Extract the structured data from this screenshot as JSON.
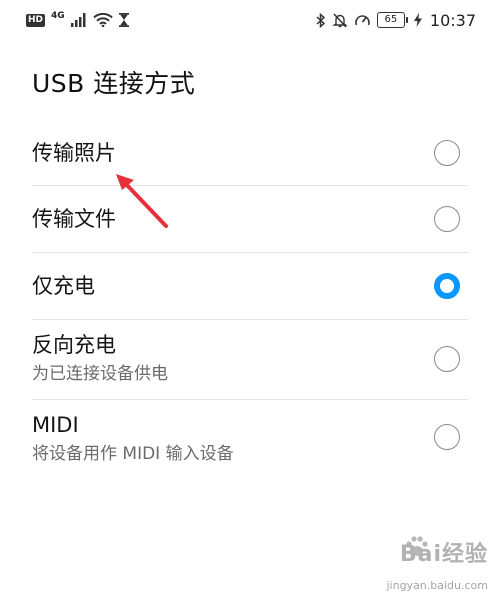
{
  "status_bar": {
    "hd": "HD",
    "network": "4G",
    "battery_level": "65",
    "time": "10:37"
  },
  "page": {
    "title": "USB 连接方式"
  },
  "options": [
    {
      "label": "传输照片",
      "description": "",
      "selected": false
    },
    {
      "label": "传输文件",
      "description": "",
      "selected": false
    },
    {
      "label": "仅充电",
      "description": "",
      "selected": true
    },
    {
      "label": "反向充电",
      "description": "为已连接设备供电",
      "selected": false
    },
    {
      "label": "MIDI",
      "description": "将设备用作 MIDI 输入设备",
      "selected": false
    }
  ],
  "watermark": {
    "logo": "Bai经验",
    "url": "jingyan.baidu.com"
  },
  "colors": {
    "accent": "#0a97ff",
    "annotation_arrow": "#e8303a",
    "divider": "#e4e4e4"
  }
}
